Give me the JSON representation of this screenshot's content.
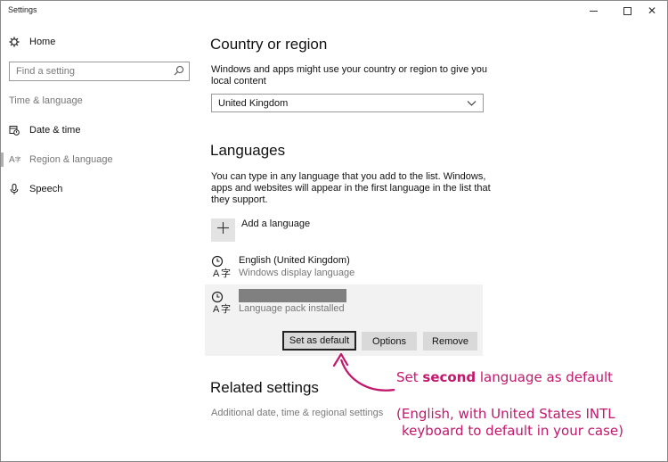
{
  "window": {
    "title": "Settings",
    "minimize_icon": "minimize-icon",
    "maximize_icon": "maximize-icon",
    "close_icon": "close-icon",
    "close_glyph": "✕"
  },
  "sidebar": {
    "home_label": "Home",
    "search_placeholder": "Find a setting",
    "section_label": "Time & language",
    "items": [
      {
        "label": "Date & time",
        "icon": "calendar-clock-icon"
      },
      {
        "label": "Region & language",
        "icon": "region-language-icon"
      },
      {
        "label": "Speech",
        "icon": "microphone-icon"
      }
    ]
  },
  "main": {
    "country": {
      "heading": "Country or region",
      "description_line1": "Windows and apps might use your country or region to give you",
      "description_line2": "local content",
      "selected_value": "United Kingdom"
    },
    "languages": {
      "heading": "Languages",
      "description_line1": "You can type in any language that you add to the list. Windows,",
      "description_line2": "apps and websites will appear in the first language in the list that",
      "description_line3": "they support.",
      "add_label": "Add a language",
      "items": [
        {
          "name": "English (United Kingdom)",
          "status": "Windows display language"
        },
        {
          "name": "",
          "status": "Language pack installed"
        }
      ],
      "buttons": {
        "set_default": "Set as default",
        "options": "Options",
        "remove": "Remove"
      }
    },
    "related": {
      "heading": "Related settings",
      "link": "Additional date, time & regional settings"
    }
  },
  "annotation": {
    "line1_prefix": "Set ",
    "line1_bold": "second",
    "line1_suffix": " language as default",
    "line2": "(English, with United States INTL",
    "line3": "keyboard to default in your case)",
    "color": "#c2186b"
  },
  "colors": {
    "selected_row": "#f2f2f2",
    "button": "#d9d9d9",
    "secondary_text": "#767676"
  }
}
